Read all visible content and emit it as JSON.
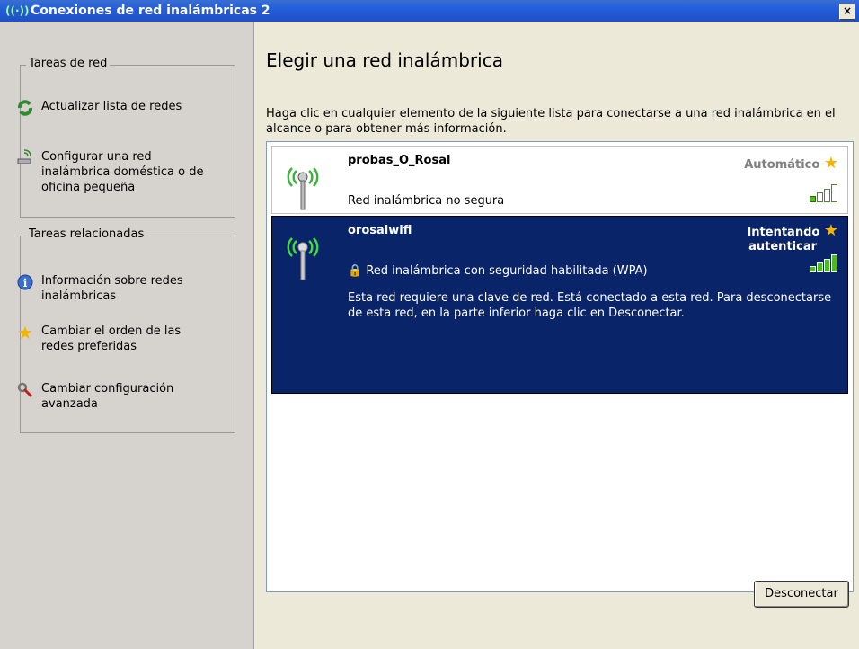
{
  "window": {
    "title": "Conexiones de red inalámbricas 2",
    "close_label": "×"
  },
  "sidebar": {
    "group1": {
      "title": "Tareas de red",
      "items": [
        {
          "label": "Actualizar lista de redes",
          "icon": "refresh-icon"
        },
        {
          "label": "Configurar una red inalámbrica doméstica o de oficina pequeña",
          "icon": "wizard-icon"
        }
      ]
    },
    "group2": {
      "title": "Tareas relacionadas",
      "items": [
        {
          "label": "Información sobre redes inalámbricas",
          "icon": "info-icon"
        },
        {
          "label": "Cambiar el orden de las redes preferidas",
          "icon": "star-icon"
        },
        {
          "label": "Cambiar configuración avanzada",
          "icon": "settings-icon"
        }
      ]
    }
  },
  "main": {
    "heading": "Elegir una red inalámbrica",
    "intro": "Haga clic en cualquier elemento de la siguiente lista para conectarse a una red inalámbrica en el alcance o para obtener más información.",
    "networks": [
      {
        "name": "probas_O_Rosal",
        "status": "Automático",
        "security": "Red inalámbrica no segura",
        "signal_bars": 1,
        "selected": false
      },
      {
        "name": "orosalwifi",
        "status_line1": "Intentando",
        "status_line2": "autenticar",
        "security": "Red inalámbrica con seguridad habilitada (WPA)",
        "description": "Esta red requiere una clave de red. Está conectado a esta red. Para desconectarse de esta red, en la parte inferior haga clic en Desconectar.",
        "signal_bars": 4,
        "selected": true
      }
    ],
    "disconnect_label": "Desconectar"
  },
  "colors": {
    "selected_bg": "#0a246a",
    "title_bar": "#245edb",
    "signal_green": "#4cbb17"
  }
}
